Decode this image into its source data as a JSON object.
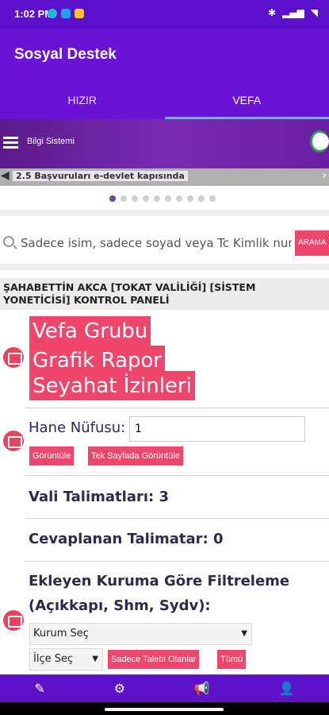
{
  "status_bar": {
    "time": "1:02 PM"
  },
  "app": {
    "title": "Sosyal Destek"
  },
  "tabs": [
    {
      "label": "HIZIR"
    },
    {
      "label": "VEFA"
    }
  ],
  "web_banner": {
    "menu_label": "Bilgi Sistemi",
    "news_text": "2.5 Başvuruları e-devlet kapısında"
  },
  "search": {
    "placeholder": "Sadece isim, sadece soyad veya Tc Kimlik numarası",
    "button_label": "ARAMA"
  },
  "panel": {
    "title": "ŞAHABETTİN AKCA [TOKAT VALİLİĞİ] [SİSTEM YONETİCİSİ] KONTROL PANELİ"
  },
  "menu_buttons": [
    "Vefa Grubu",
    "Grafik Rapor",
    "Seyahat İzinleri"
  ],
  "hane": {
    "label": "Hane Nüfusu:",
    "value": "1",
    "view_label": "Görüntüle",
    "single_page_label": "Tek Sayfada Görüntüle"
  },
  "vali": {
    "label": "Vali Talimatları: 3"
  },
  "cevap": {
    "label": "Cevaplanan Talimatar: 0"
  },
  "filter": {
    "title_line1": "Ekleyen Kuruma Göre Filtreleme",
    "title_line2": "(Açıkkapı, Shm, Sydv):",
    "kurum_select": "Kurum Seç",
    "ilce_select": "İlçe Seç",
    "talep_button": "Sadece Talebi Olanlar",
    "all_button": "Tümü"
  },
  "colors": {
    "primary": "#6a12d6",
    "accent": "#f0466c",
    "tab_indicator": "#34d0ff"
  }
}
